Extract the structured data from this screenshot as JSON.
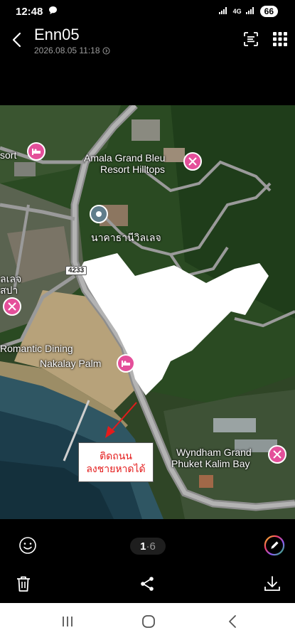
{
  "status": {
    "time": "12:48",
    "network": "4G",
    "battery": "66"
  },
  "header": {
    "title": "Enn05",
    "subtitle": "2026.08.05 11:18"
  },
  "map": {
    "labels": {
      "sort": "sort",
      "amala_line1": "Amala Grand Bleu",
      "amala_line2": "Resort Hilltops",
      "thai_place": "นาคาธานีวิลเลจ",
      "road_number": "4233",
      "spa_line1": "ลเลจ",
      "spa_line2": "สปา",
      "romantic": "Romantic Dining",
      "nakalay": "Nakalay Palm",
      "wyndham_line1": "Wyndham Grand",
      "wyndham_line2": "Phuket Kalim Bay"
    },
    "note": {
      "line1": "ติดถนน",
      "line2": "ลงชายหาดได้"
    }
  },
  "viewer": {
    "page_current": "1",
    "page_sep": "·",
    "page_total": "6"
  },
  "colors": {
    "pin": "#e44f9a",
    "annotation": "#e41b1b",
    "background": "#000000"
  }
}
